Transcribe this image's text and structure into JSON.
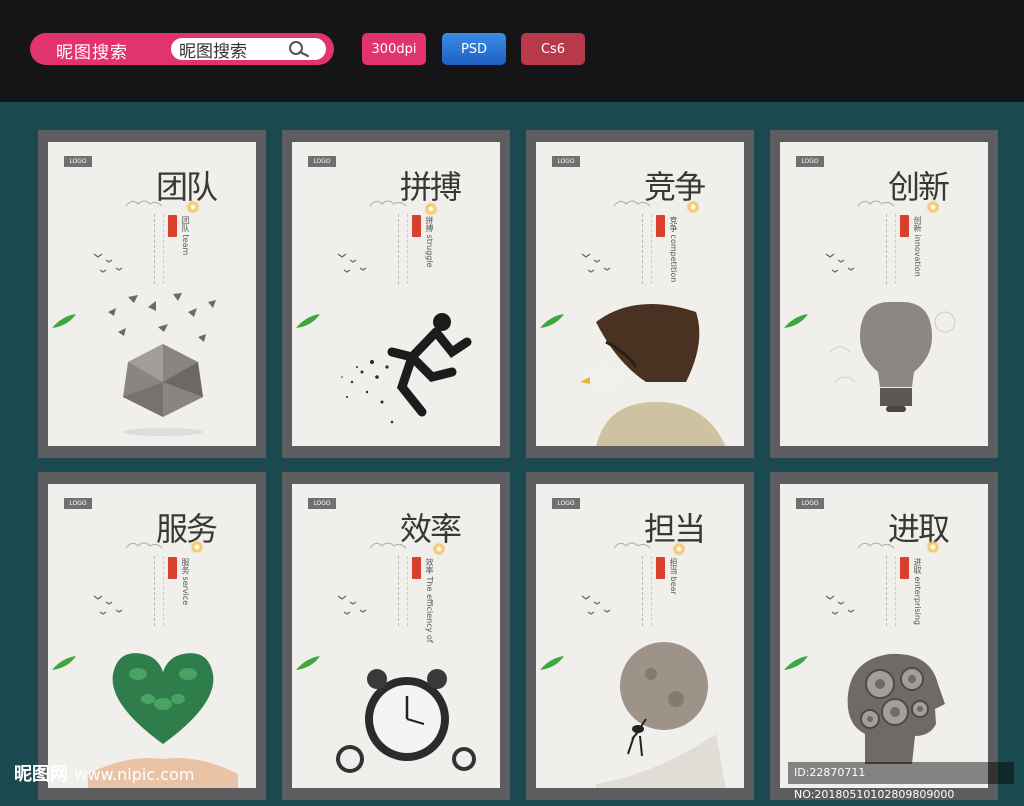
{
  "header": {
    "search_label": "昵图搜索",
    "search_value": "昵图搜索",
    "badges": [
      "300dpi",
      "PSD",
      "Cs6"
    ]
  },
  "posters": [
    {
      "logo": "LOGO",
      "title": "团队",
      "subtitle": "团队 team",
      "art": "crystal-sphere-birds"
    },
    {
      "logo": "LOGO",
      "title": "拼搏",
      "subtitle": "拼搏 struggle",
      "art": "running-man"
    },
    {
      "logo": "LOGO",
      "title": "竞争",
      "subtitle": "竞争 competition",
      "art": "eagle"
    },
    {
      "logo": "LOGO",
      "title": "创新",
      "subtitle": "创新 innovation",
      "art": "light-bulb"
    },
    {
      "logo": "LOGO",
      "title": "服务",
      "subtitle": "服务 service",
      "art": "leaf-heart-hand"
    },
    {
      "logo": "LOGO",
      "title": "效率",
      "subtitle": "效率 The efficiency of",
      "art": "alarm-clock"
    },
    {
      "logo": "LOGO",
      "title": "担当",
      "subtitle": "担当 bear",
      "art": "ant-pushing-boulder"
    },
    {
      "logo": "LOGO",
      "title": "进取",
      "subtitle": "进取 enterprising",
      "art": "gear-head"
    }
  ],
  "watermark": {
    "brand": "昵图网",
    "url": "www.nipic.com",
    "id_text": "ID:22870711 NO:20180510102809809000"
  },
  "colors": {
    "page_bg": "#1a4a4f",
    "topbar_bg": "#151517",
    "pink": "#e0336f",
    "psd_blue": "#1e5fc2",
    "cs6_red": "#b8394a",
    "seal_red": "#d93f2d"
  }
}
